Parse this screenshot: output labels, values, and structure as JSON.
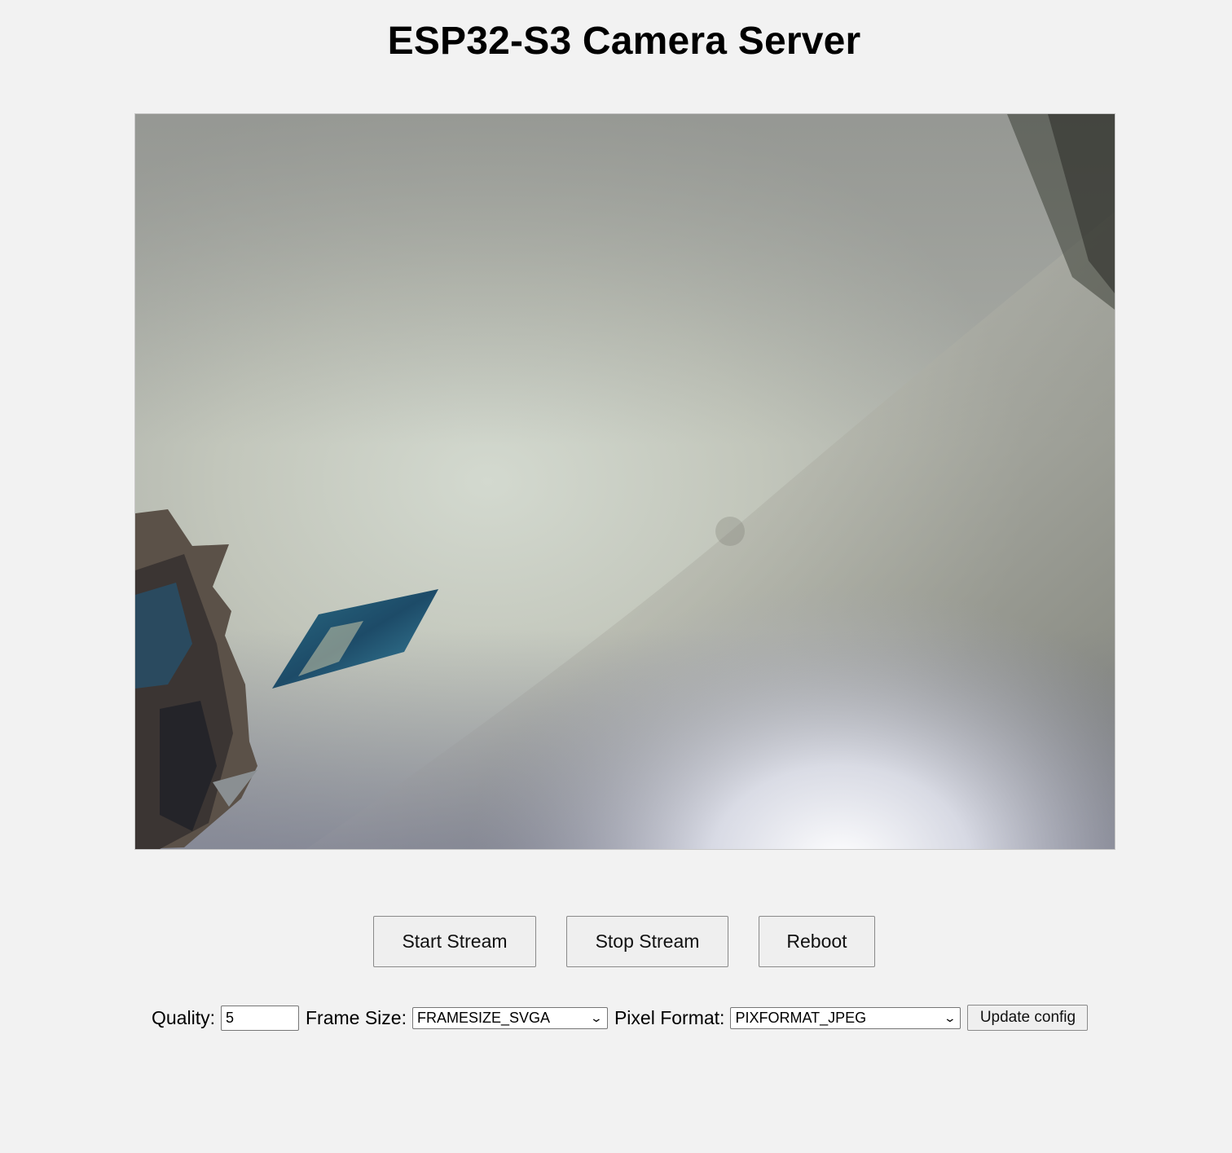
{
  "page": {
    "title": "ESP32-S3 Camera Server"
  },
  "stream": {
    "image_icon": "camera-stream-image"
  },
  "controls": {
    "start_label": "Start Stream",
    "stop_label": "Stop Stream",
    "reboot_label": "Reboot"
  },
  "config": {
    "quality_label": "Quality:",
    "quality_value": "5",
    "frame_size_label": "Frame Size:",
    "frame_size_value": "FRAMESIZE_SVGA",
    "pixel_format_label": "Pixel Format:",
    "pixel_format_value": "PIXFORMAT_JPEG",
    "update_label": "Update config"
  }
}
